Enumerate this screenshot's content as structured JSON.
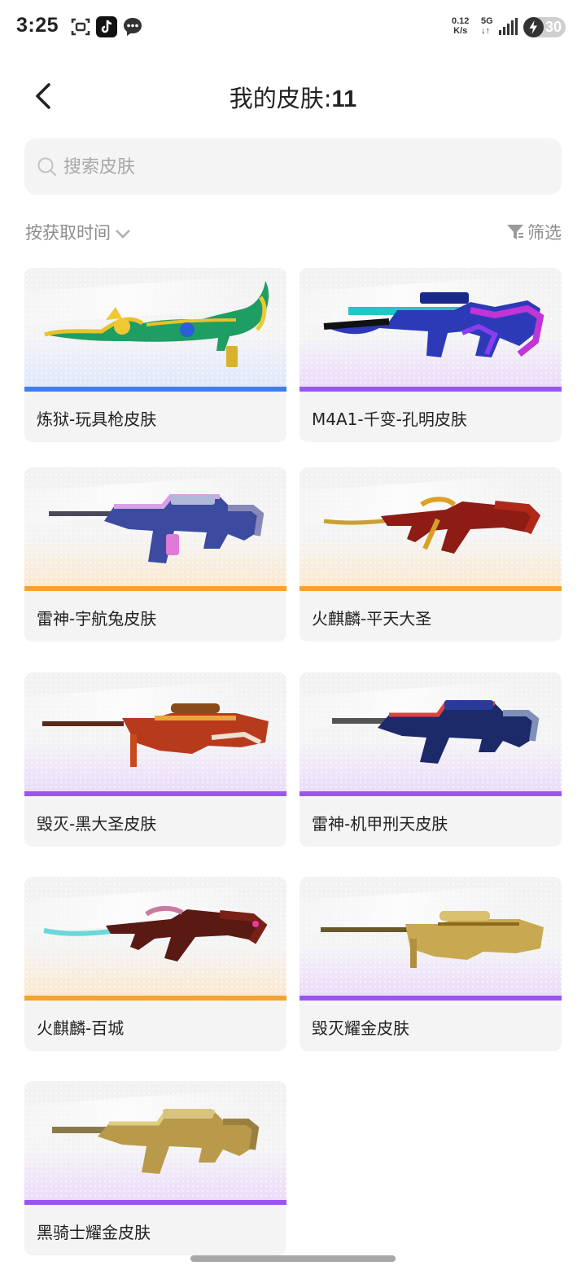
{
  "status_bar": {
    "time": "3:25",
    "net_speed_value": "0.12",
    "net_speed_unit": "K/s",
    "network_type": "5G",
    "battery": "30"
  },
  "header": {
    "title_prefix": "我的皮肤:",
    "title_count": "11"
  },
  "search": {
    "placeholder": "搜索皮肤"
  },
  "sort": {
    "label": "按获取时间"
  },
  "filter": {
    "label": "筛选"
  },
  "colors": {
    "blue_rarity": "#3f7ef0",
    "purple_rarity": "#9a55f0",
    "orange_rarity": "#f6a22e"
  },
  "skins": [
    {
      "name": "炼狱-玩具枪皮肤",
      "rarity": "blue",
      "icon": "dragon-rifle-icon"
    },
    {
      "name": "M4A1-千变-孔明皮肤",
      "rarity": "purple",
      "icon": "m4a1-rifle-icon"
    },
    {
      "name": "雷神-宇航兔皮肤",
      "rarity": "orange",
      "icon": "assault-rifle-icon"
    },
    {
      "name": "火麒麟-平天大圣",
      "rarity": "orange",
      "icon": "ak-rifle-icon"
    },
    {
      "name": "毁灭-黑大圣皮肤",
      "rarity": "purple",
      "icon": "sniper-rifle-icon"
    },
    {
      "name": "雷神-机甲刑天皮肤",
      "rarity": "purple",
      "icon": "assault-rifle-icon"
    },
    {
      "name": "火麒麟-百城",
      "rarity": "orange",
      "icon": "ak-rifle-icon"
    },
    {
      "name": "毁灭耀金皮肤",
      "rarity": "purple",
      "icon": "sniper-rifle-icon"
    },
    {
      "name": "黑骑士耀金皮肤",
      "rarity": "purple",
      "icon": "m4a1-rifle-icon"
    }
  ]
}
